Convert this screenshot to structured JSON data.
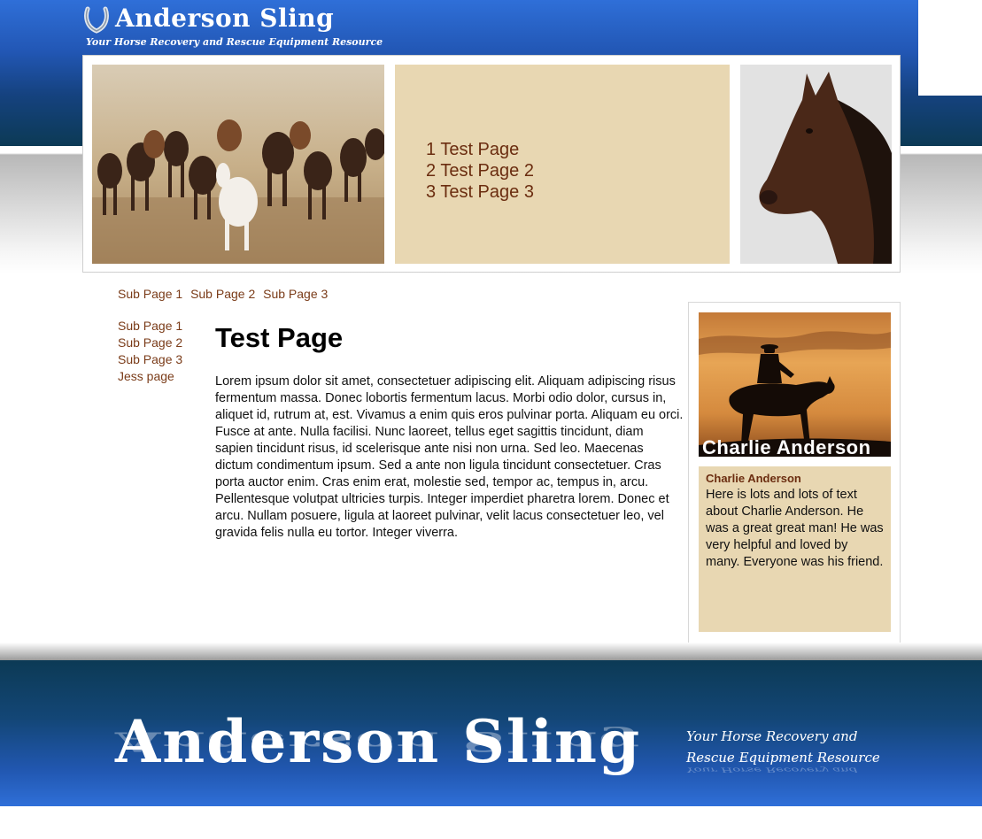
{
  "header": {
    "title": "Anderson Sling",
    "tagline": "Your Horse Recovery and Rescue Equipment Resource"
  },
  "hero_menu": {
    "items": [
      "1 Test Page",
      "2 Test Page 2",
      "3 Test Page 3"
    ]
  },
  "subnav": {
    "items": [
      "Sub Page 1",
      "Sub Page 2",
      "Sub Page 3"
    ]
  },
  "sidenav": {
    "items": [
      "Sub Page 1",
      "Sub Page 2",
      "Sub Page 3",
      "Jess page"
    ]
  },
  "main": {
    "title": "Test Page",
    "body": "Lorem ipsum dolor sit amet, consectetuer adipiscing elit. Aliquam adipiscing risus fermentum massa. Donec lobortis fermentum lacus. Morbi odio dolor, cursus in, aliquet id, rutrum at, est. Vivamus a enim quis eros pulvinar porta. Aliquam eu orci. Fusce at ante. Nulla facilisi. Nunc laoreet, tellus eget sagittis tincidunt, diam sapien tincidunt risus, id scelerisque ante nisi non urna. Sed leo. Maecenas dictum condimentum ipsum. Sed a ante non ligula tincidunt consectetuer. Cras porta auctor enim. Cras enim erat, molestie sed, tempor ac, tempus in, arcu. Pellentesque volutpat ultricies turpis. Integer imperdiet pharetra lorem. Donec et arcu. Nullam posuere, ligula at laoreet pulvinar, velit lacus consectetuer leo, vel gravida felis nulla eu tortor. Integer viverra."
  },
  "profile": {
    "caption": "Charlie Anderson",
    "name": "Charlie Anderson",
    "text": "Here is lots and lots of text about Charlie Anderson. He was a great great man! He was very helpful and loved by many. Everyone was his friend."
  },
  "footer": {
    "title": "Anderson Sling",
    "tagline": "Your Horse Recovery and Rescue Equipment Resource"
  },
  "colors": {
    "header_blue": "#2f6fd8",
    "dark_teal": "#0c3a55",
    "tan": "#e8d7b2",
    "link_brown": "#7a3b18"
  },
  "icons": {
    "logo": "horseshoe-icon"
  }
}
